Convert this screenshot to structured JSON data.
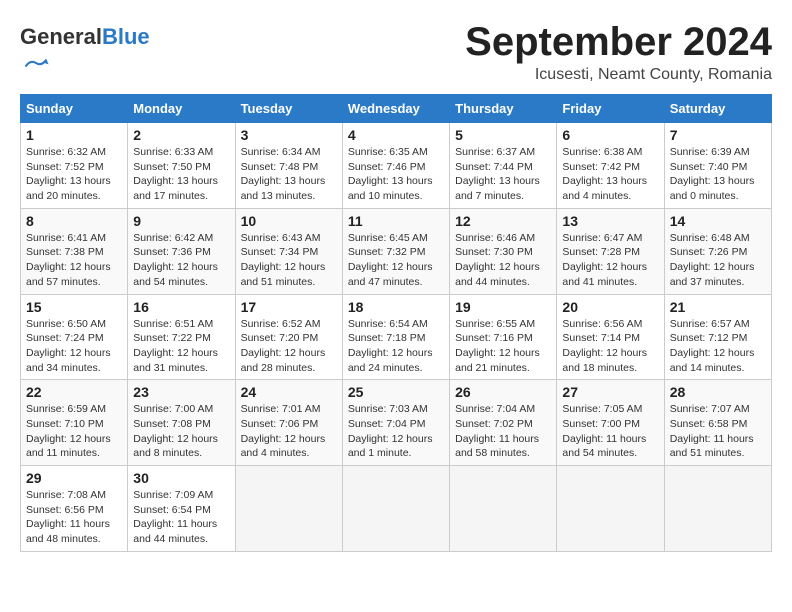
{
  "header": {
    "logo_general": "General",
    "logo_blue": "Blue",
    "month_title": "September 2024",
    "location": "Icusesti, Neamt County, Romania"
  },
  "calendar": {
    "days_of_week": [
      "Sunday",
      "Monday",
      "Tuesday",
      "Wednesday",
      "Thursday",
      "Friday",
      "Saturday"
    ],
    "weeks": [
      [
        {
          "day": "",
          "info": ""
        },
        {
          "day": "2",
          "info": "Sunrise: 6:33 AM\nSunset: 7:50 PM\nDaylight: 13 hours and 17 minutes."
        },
        {
          "day": "3",
          "info": "Sunrise: 6:34 AM\nSunset: 7:48 PM\nDaylight: 13 hours and 13 minutes."
        },
        {
          "day": "4",
          "info": "Sunrise: 6:35 AM\nSunset: 7:46 PM\nDaylight: 13 hours and 10 minutes."
        },
        {
          "day": "5",
          "info": "Sunrise: 6:37 AM\nSunset: 7:44 PM\nDaylight: 13 hours and 7 minutes."
        },
        {
          "day": "6",
          "info": "Sunrise: 6:38 AM\nSunset: 7:42 PM\nDaylight: 13 hours and 4 minutes."
        },
        {
          "day": "7",
          "info": "Sunrise: 6:39 AM\nSunset: 7:40 PM\nDaylight: 13 hours and 0 minutes."
        }
      ],
      [
        {
          "day": "8",
          "info": "Sunrise: 6:41 AM\nSunset: 7:38 PM\nDaylight: 12 hours and 57 minutes."
        },
        {
          "day": "9",
          "info": "Sunrise: 6:42 AM\nSunset: 7:36 PM\nDaylight: 12 hours and 54 minutes."
        },
        {
          "day": "10",
          "info": "Sunrise: 6:43 AM\nSunset: 7:34 PM\nDaylight: 12 hours and 51 minutes."
        },
        {
          "day": "11",
          "info": "Sunrise: 6:45 AM\nSunset: 7:32 PM\nDaylight: 12 hours and 47 minutes."
        },
        {
          "day": "12",
          "info": "Sunrise: 6:46 AM\nSunset: 7:30 PM\nDaylight: 12 hours and 44 minutes."
        },
        {
          "day": "13",
          "info": "Sunrise: 6:47 AM\nSunset: 7:28 PM\nDaylight: 12 hours and 41 minutes."
        },
        {
          "day": "14",
          "info": "Sunrise: 6:48 AM\nSunset: 7:26 PM\nDaylight: 12 hours and 37 minutes."
        }
      ],
      [
        {
          "day": "15",
          "info": "Sunrise: 6:50 AM\nSunset: 7:24 PM\nDaylight: 12 hours and 34 minutes."
        },
        {
          "day": "16",
          "info": "Sunrise: 6:51 AM\nSunset: 7:22 PM\nDaylight: 12 hours and 31 minutes."
        },
        {
          "day": "17",
          "info": "Sunrise: 6:52 AM\nSunset: 7:20 PM\nDaylight: 12 hours and 28 minutes."
        },
        {
          "day": "18",
          "info": "Sunrise: 6:54 AM\nSunset: 7:18 PM\nDaylight: 12 hours and 24 minutes."
        },
        {
          "day": "19",
          "info": "Sunrise: 6:55 AM\nSunset: 7:16 PM\nDaylight: 12 hours and 21 minutes."
        },
        {
          "day": "20",
          "info": "Sunrise: 6:56 AM\nSunset: 7:14 PM\nDaylight: 12 hours and 18 minutes."
        },
        {
          "day": "21",
          "info": "Sunrise: 6:57 AM\nSunset: 7:12 PM\nDaylight: 12 hours and 14 minutes."
        }
      ],
      [
        {
          "day": "22",
          "info": "Sunrise: 6:59 AM\nSunset: 7:10 PM\nDaylight: 12 hours and 11 minutes."
        },
        {
          "day": "23",
          "info": "Sunrise: 7:00 AM\nSunset: 7:08 PM\nDaylight: 12 hours and 8 minutes."
        },
        {
          "day": "24",
          "info": "Sunrise: 7:01 AM\nSunset: 7:06 PM\nDaylight: 12 hours and 4 minutes."
        },
        {
          "day": "25",
          "info": "Sunrise: 7:03 AM\nSunset: 7:04 PM\nDaylight: 12 hours and 1 minute."
        },
        {
          "day": "26",
          "info": "Sunrise: 7:04 AM\nSunset: 7:02 PM\nDaylight: 11 hours and 58 minutes."
        },
        {
          "day": "27",
          "info": "Sunrise: 7:05 AM\nSunset: 7:00 PM\nDaylight: 11 hours and 54 minutes."
        },
        {
          "day": "28",
          "info": "Sunrise: 7:07 AM\nSunset: 6:58 PM\nDaylight: 11 hours and 51 minutes."
        }
      ],
      [
        {
          "day": "29",
          "info": "Sunrise: 7:08 AM\nSunset: 6:56 PM\nDaylight: 11 hours and 48 minutes."
        },
        {
          "day": "30",
          "info": "Sunrise: 7:09 AM\nSunset: 6:54 PM\nDaylight: 11 hours and 44 minutes."
        },
        {
          "day": "",
          "info": ""
        },
        {
          "day": "",
          "info": ""
        },
        {
          "day": "",
          "info": ""
        },
        {
          "day": "",
          "info": ""
        },
        {
          "day": "",
          "info": ""
        }
      ]
    ],
    "week1_day1": {
      "day": "1",
      "info": "Sunrise: 6:32 AM\nSunset: 7:52 PM\nDaylight: 13 hours and 20 minutes."
    }
  }
}
